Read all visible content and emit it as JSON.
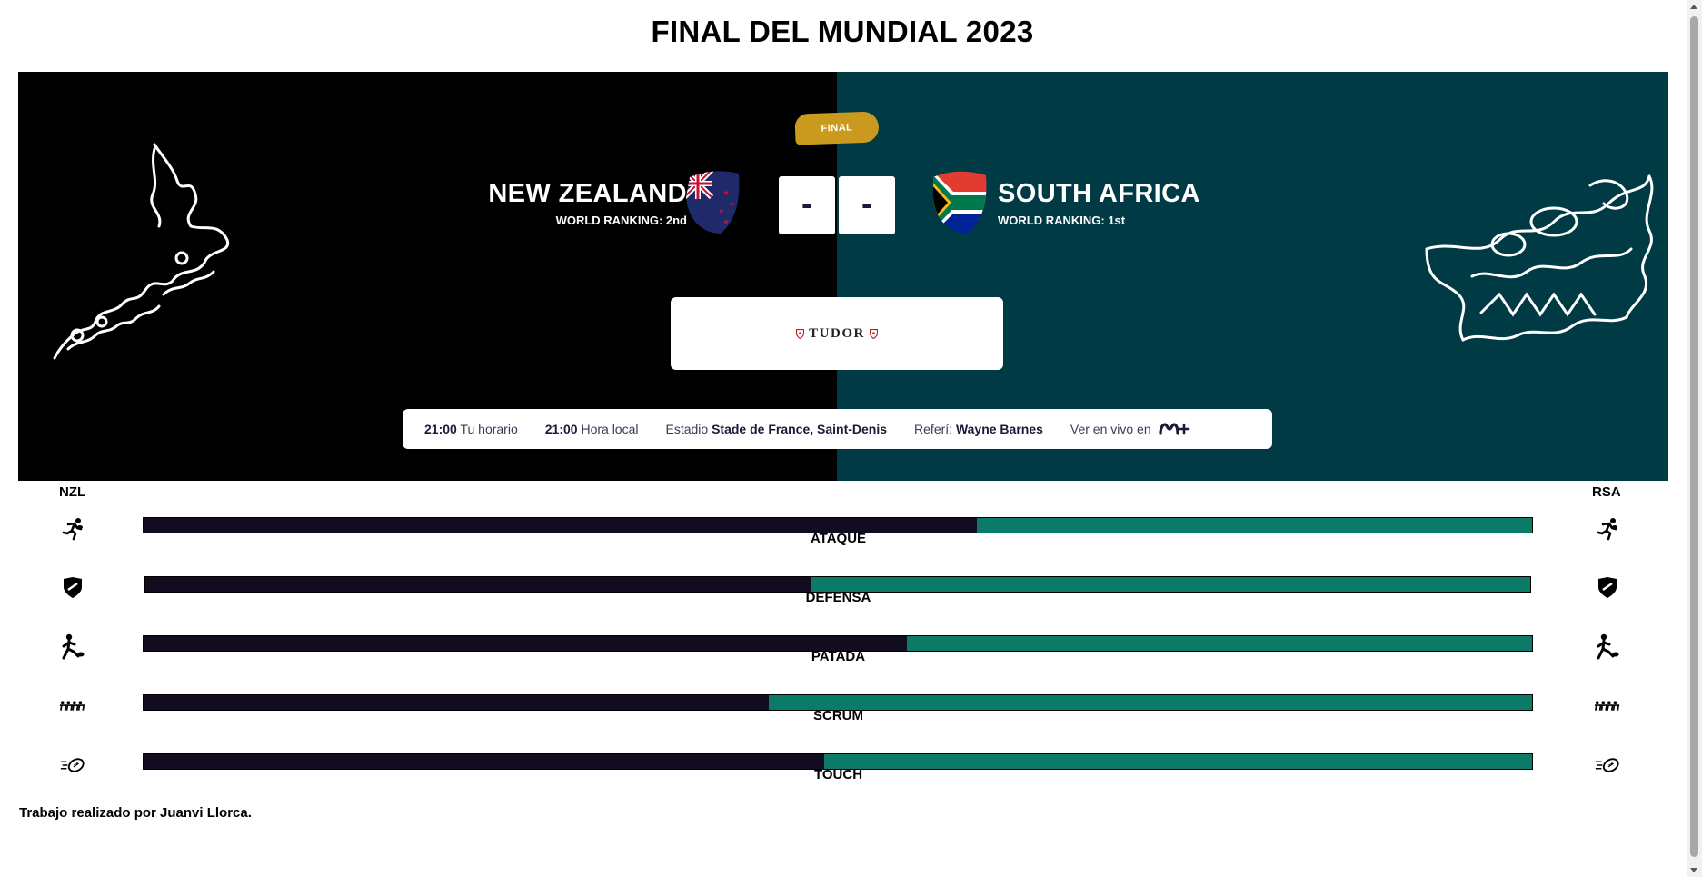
{
  "page": {
    "title": "FINAL DEL MUNDIAL 2023"
  },
  "match": {
    "stage": "FINAL",
    "home": {
      "name": "NEW ZEALAND",
      "ranking": "WORLD RANKING: 2nd",
      "code": "NZL",
      "score": "-"
    },
    "away": {
      "name": "SOUTH AFRICA",
      "ranking": "WORLD RANKING: 1st",
      "code": "RSA",
      "score": "-"
    },
    "sponsor": "TUDOR",
    "info": {
      "your_time": "21:00",
      "your_time_label": "Tu horario",
      "local_time": "21:00",
      "local_time_label": "Hora local",
      "stadium_label": "Estadio",
      "stadium": "Stade de France, Saint-Denis",
      "referee_label": "Referí:",
      "referee": "Wayne Barnes",
      "live_label": "Ver en vivo en",
      "broadcaster_icon": "movistar-plus-logo"
    }
  },
  "stats": [
    {
      "label": "ATAQUE",
      "icon": "runner-icon",
      "home_share": 0.6
    },
    {
      "label": "DEFENSA",
      "icon": "shield-icon",
      "home_share": 0.48
    },
    {
      "label": "PATADA",
      "icon": "kick-icon",
      "home_share": 0.55
    },
    {
      "label": "SCRUM",
      "icon": "scrum-icon",
      "home_share": 0.45
    },
    {
      "label": "TOUCH",
      "icon": "ball-icon",
      "home_share": 0.49
    }
  ],
  "colors": {
    "home_bar": "#120c1e",
    "away_bar": "#0b7a66",
    "home_bg": "#000000",
    "away_bg": "#003a45",
    "pill": "#c99a1e"
  },
  "footer": {
    "text": "Trabajo realizado por Juanvi Llorca."
  }
}
